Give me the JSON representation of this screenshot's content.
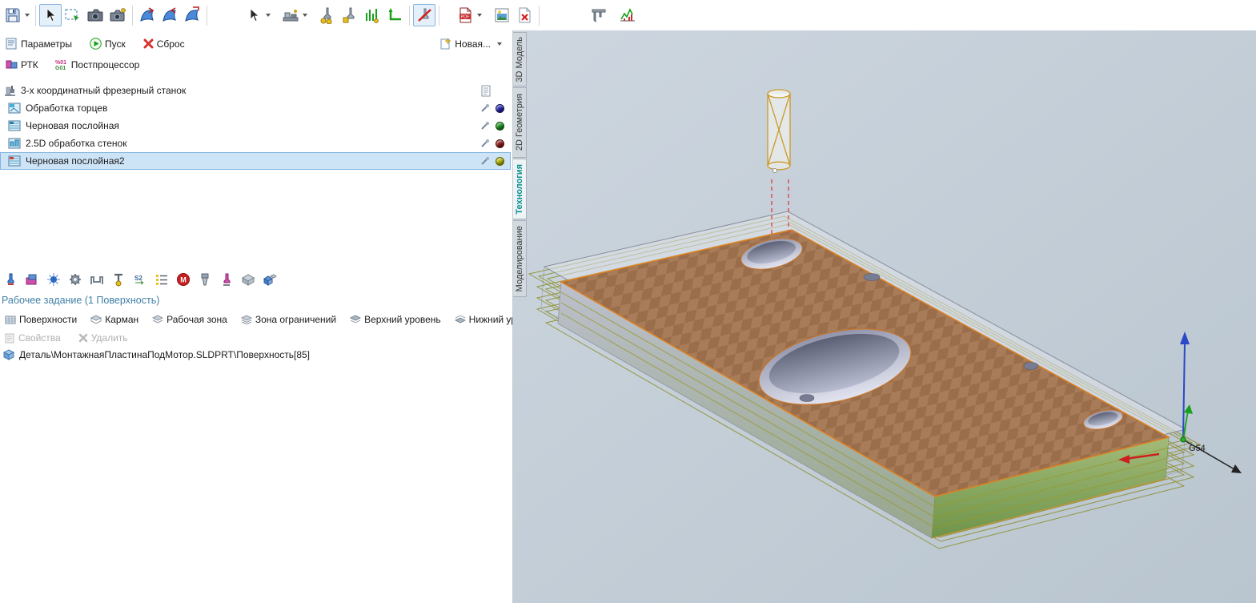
{
  "toolbar": {
    "icons": [
      "save-icon",
      "select-cursor-icon",
      "marquee-select-icon",
      "camera-icon",
      "camera-view-icon",
      "surface-sheet-icon-1",
      "surface-sheet-icon-2",
      "surface-sheet-icon-3",
      "pick-cursor-icon",
      "machine-vise-icon",
      "tool-coins-icon",
      "tool-setup-icon",
      "toolpath-green-icon",
      "corner-green-icon",
      "no-machining-icon",
      "pdf-export-icon",
      "image-export-icon",
      "delete-doc-icon",
      "caliper-icon",
      "statistics-icon"
    ]
  },
  "panel": {
    "controls": {
      "parameters": "Параметры",
      "run": "Пуск",
      "reset": "Сброс",
      "new_operation": "Новая...",
      "rtk": "РТК",
      "postprocessor": "Постпроцессор"
    },
    "tree": {
      "machine": "3-х координатный фрезерный станок",
      "operations": [
        {
          "label": "Обработка торцев",
          "dot_color": "#2424a8",
          "selected": false
        },
        {
          "label": "Черновая послойная",
          "dot_color": "#169016",
          "selected": false
        },
        {
          "label": "2.5D обработка стенок",
          "dot_color": "#8e1616",
          "selected": false
        },
        {
          "label": "Черновая послойная2",
          "dot_color": "#b4b400",
          "selected": true
        }
      ]
    },
    "midbar_icons": [
      "tool-icon",
      "workpiece-icon",
      "spindle-icon",
      "gear-icon",
      "fixture-icon",
      "tool-number-icon",
      "spindle-speed-icon",
      "operations-list-icon",
      "m-function-icon",
      "holder-icon",
      "tool-magenta-icon",
      "stock-icon",
      "model-icon"
    ],
    "job": {
      "title": "Рабочее задание (1 Поверхность)",
      "buttons": [
        "Поверхности",
        "Карман",
        "Рабочая зона",
        "Зона ограничений",
        "Верхний уровень",
        "Нижний уровень"
      ],
      "disabled_buttons": [
        "Свойства",
        "Удалить"
      ],
      "item": "Деталь\\МонтажнаяПластинаПодМотор.SLDPRT\\Поверхность[85]"
    }
  },
  "viewport": {
    "tabs": [
      {
        "label": "3D Модель",
        "active": false
      },
      {
        "label": "2D Геометрия",
        "active": false
      },
      {
        "label": "Технология",
        "active": true
      },
      {
        "label": "Моделирование",
        "active": false
      }
    ],
    "axis_label": "G54",
    "colors": {
      "background_top": "#cdd6df",
      "background_bottom": "#b9c5cf",
      "part_top": "#a87c58",
      "part_side_green": "#6e9448",
      "toolpath": "#8f9030",
      "tool_outline": "#cc9a2a",
      "rapid_move_red": "#e04545",
      "axis_x": "#cc2020",
      "axis_y": "#18a018",
      "axis_z": "#2a48c8",
      "active_tab": "#0a9090",
      "selection": "#cde4f7",
      "part_edge": "#e0811f"
    }
  }
}
